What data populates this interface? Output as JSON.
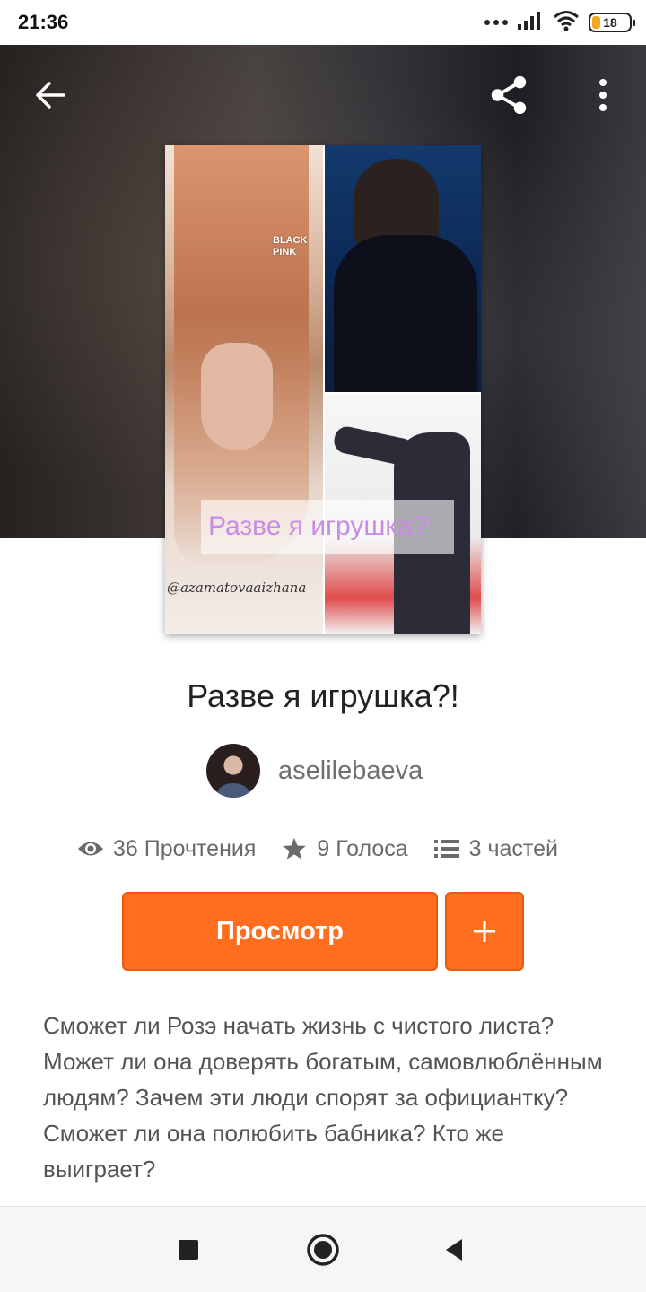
{
  "status_bar": {
    "time": "21:36",
    "battery": "18",
    "icons": [
      "dots-icon",
      "signal-icon",
      "wifi-icon",
      "battery-icon"
    ]
  },
  "header": {
    "icons": [
      "back-arrow-icon",
      "share-icon",
      "more-vertical-icon"
    ]
  },
  "cover": {
    "title_text": "Разве я игрушка?!",
    "credit_text": "@azamatovaaizhana"
  },
  "book": {
    "title": "Разве я игрушка?!",
    "author": "aselilebaeva"
  },
  "stats": {
    "reads": "36 Прочтения",
    "votes": "9 Голоса",
    "parts": "3 частей"
  },
  "actions": {
    "read_label": "Просмотр",
    "add_icon": "plus-icon"
  },
  "description": "Сможет ли Розэ начать жизнь с чистого листа? Может ли она доверять богатым, самовлюблённым людям? Зачем эти люди спорят за официантку? Сможет ли она полюбить бабника? Кто же выиграет?",
  "nav_bar": {
    "icons": [
      "recent-apps-icon",
      "home-icon",
      "nav-back-icon"
    ]
  },
  "colors": {
    "accent": "#ff6d1f",
    "text_primary": "#222222",
    "text_secondary": "#6a6a6a"
  }
}
